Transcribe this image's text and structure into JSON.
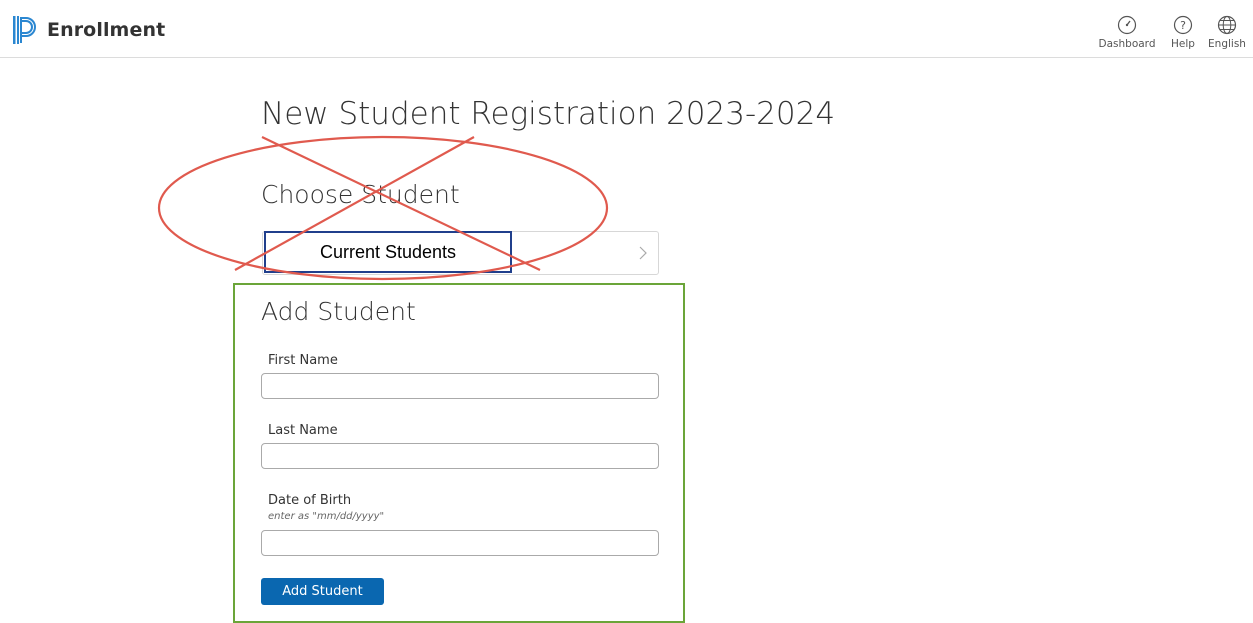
{
  "header": {
    "app_title": "Enrollment",
    "nav": [
      {
        "label": "Dashboard",
        "icon": "dashboard-gauge-icon"
      },
      {
        "label": "Help",
        "icon": "help-question-icon"
      },
      {
        "label": "English",
        "icon": "globe-icon"
      }
    ]
  },
  "page": {
    "title": "New Student Registration 2023-2024"
  },
  "choose_student": {
    "title": "Choose Student",
    "current_students_label": "Current Students"
  },
  "add_student": {
    "title": "Add Student",
    "first_name_label": "First Name",
    "first_name_value": "",
    "last_name_label": "Last Name",
    "last_name_value": "",
    "dob_label": "Date of Birth",
    "dob_hint": "enter as \"mm/dd/yyyy\"",
    "dob_value": "",
    "button_label": "Add Student"
  },
  "colors": {
    "brand_blue": "#0a67b0",
    "logo_blue": "#2b87d1",
    "annotation_red": "#e05a4e",
    "annotation_green": "#6ba539",
    "annotation_navy": "#203f8c"
  }
}
